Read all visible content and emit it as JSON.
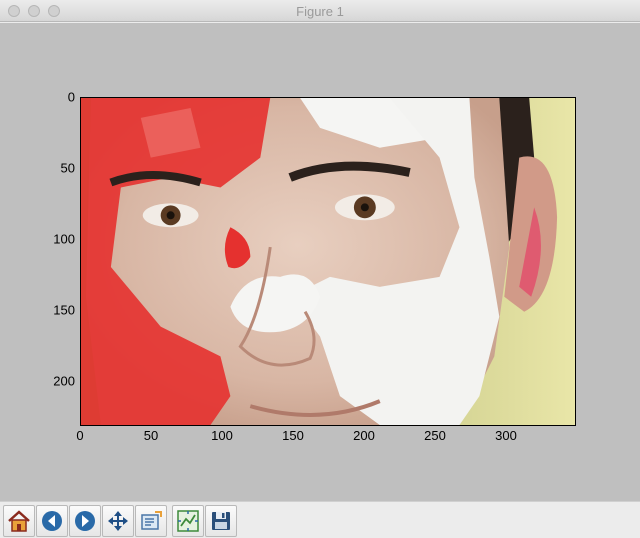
{
  "window": {
    "title": "Figure 1"
  },
  "plot": {
    "x_ticks": [
      "0",
      "50",
      "100",
      "150",
      "200",
      "250",
      "300"
    ],
    "y_ticks": [
      "0",
      "50",
      "100",
      "150",
      "200"
    ]
  },
  "toolbar": {
    "buttons": [
      {
        "name": "home-button",
        "icon": "home-icon"
      },
      {
        "name": "back-button",
        "icon": "back-arrow-icon"
      },
      {
        "name": "forward-button",
        "icon": "forward-arrow-icon"
      },
      {
        "name": "pan-button",
        "icon": "move-arrows-icon"
      },
      {
        "name": "zoom-button",
        "icon": "zoom-rect-icon"
      },
      {
        "name": "subplots-button",
        "icon": "configure-subplots-icon"
      },
      {
        "name": "save-button",
        "icon": "floppy-disk-icon"
      }
    ]
  },
  "colors": {
    "canvas": "#bfbfbf",
    "toolbar": "#ececec",
    "accent": "#2a6aa8"
  }
}
